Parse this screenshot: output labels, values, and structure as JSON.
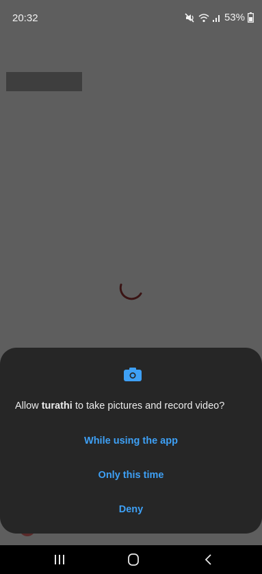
{
  "status_bar": {
    "time": "20:32",
    "battery": "53%",
    "icons": [
      "mute-icon",
      "wifi-icon",
      "signal-icon",
      "battery-icon"
    ]
  },
  "dialog": {
    "message_prefix": "Allow ",
    "app_name": "turathi",
    "message_suffix": " to take pictures and record video?",
    "icon": "camera-icon",
    "options": [
      {
        "label": "While using the app"
      },
      {
        "label": "Only this time"
      },
      {
        "label": "Deny"
      }
    ]
  },
  "nav_bar": {
    "icons": [
      "recents-icon",
      "home-icon",
      "back-icon"
    ]
  },
  "colors": {
    "accent": "#3ea0f5",
    "dialog_bg": "#262626",
    "scrim": "#5e5e5e",
    "spinner": "#3a1414"
  }
}
